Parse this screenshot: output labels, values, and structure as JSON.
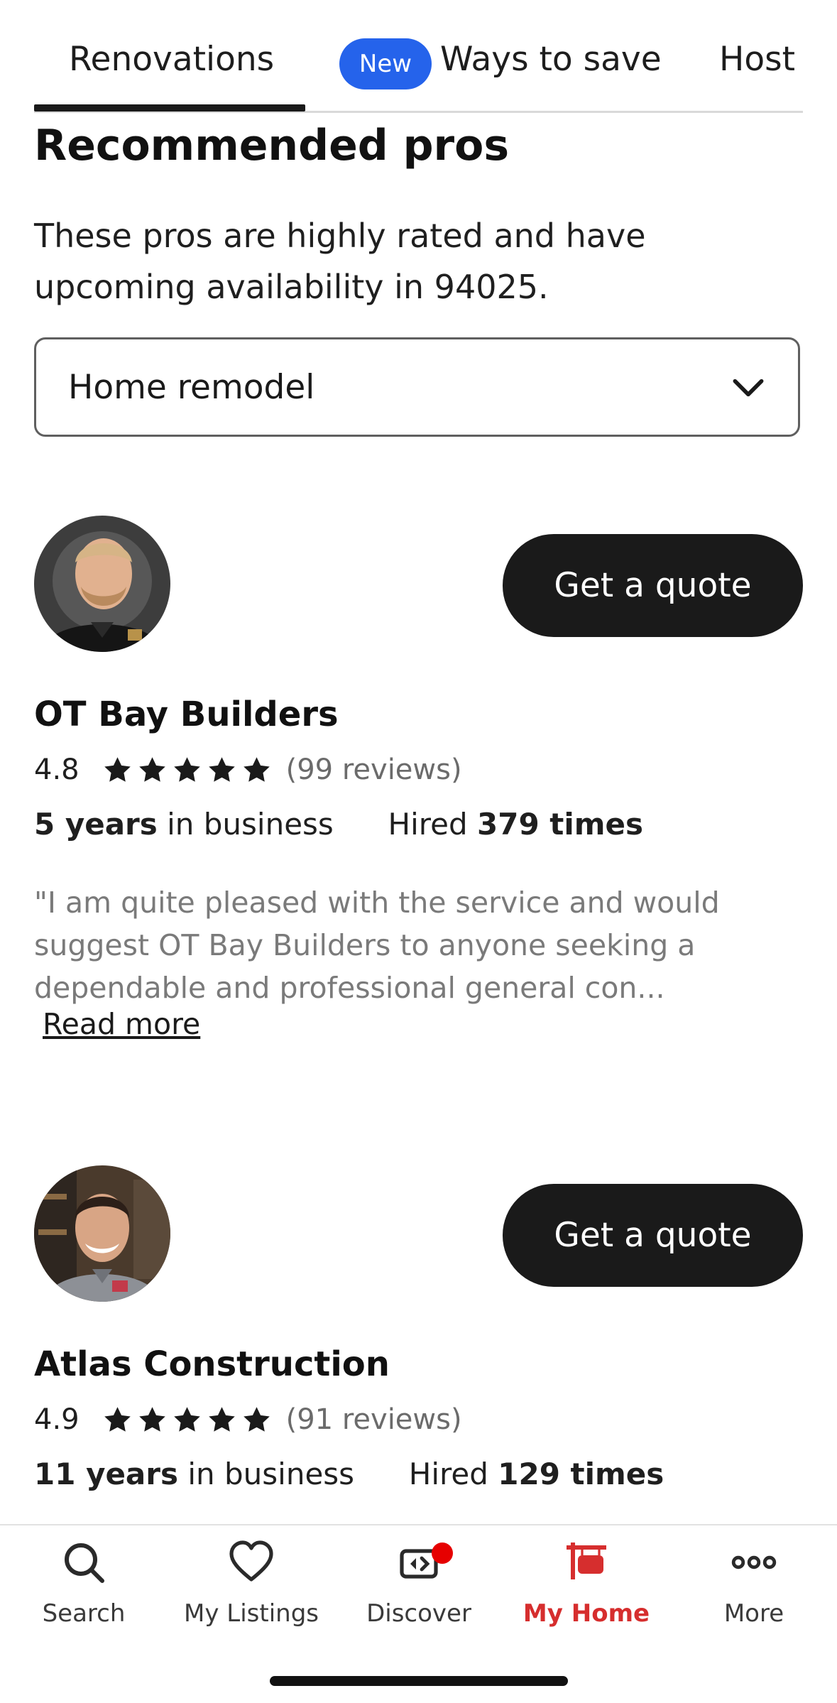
{
  "tabs": [
    {
      "label": "Renovations",
      "active": true
    },
    {
      "label": "Ways to save",
      "badge": "New"
    },
    {
      "label": "Host"
    }
  ],
  "section": {
    "title": "Recommended pros",
    "description": "These pros are highly rated and have upcoming availability in 94025."
  },
  "dropdown": {
    "value": "Home remodel",
    "icon": "chevron-down-icon"
  },
  "pros": [
    {
      "name": "OT Bay Builders",
      "rating": "4.8",
      "stars": 5,
      "reviews": "(99 reviews)",
      "years_bold": "5 years",
      "years_rest": "in business",
      "hired_pre": "Hired",
      "hired_bold": "379 times",
      "quote_button": "Get a quote",
      "review_excerpt": "\"I am quite pleased with the service and would suggest OT Bay Builders to anyone seeking a dependable and professional general con...",
      "read_more": "Read more"
    },
    {
      "name": "Atlas Construction",
      "rating": "4.9",
      "stars": 5,
      "reviews": "(91 reviews)",
      "years_bold": "11 years",
      "years_rest": "in business",
      "hired_pre": "Hired",
      "hired_bold": "129 times",
      "quote_button": "Get a quote"
    }
  ],
  "bottom_nav": [
    {
      "label": "Search",
      "icon": "search-icon"
    },
    {
      "label": "My Listings",
      "icon": "heart-icon"
    },
    {
      "label": "Discover",
      "icon": "discover-icon",
      "notification": true
    },
    {
      "label": "My Home",
      "icon": "home-sign-icon",
      "active": true
    },
    {
      "label": "More",
      "icon": "more-icon"
    }
  ],
  "colors": {
    "accent": "#d62e2e",
    "badge": "#2563eb",
    "button": "#1a1a1a"
  }
}
